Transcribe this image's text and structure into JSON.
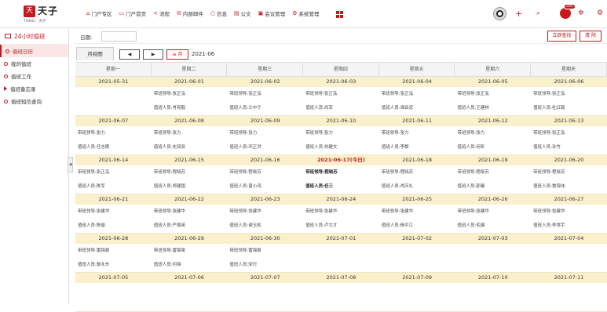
{
  "logo": {
    "brand": "天子",
    "mark": "天",
    "sub": "TIANZI · 天子"
  },
  "nav": [
    {
      "icon": "⌂",
      "label": "门户专区"
    },
    {
      "icon": "▭",
      "label": "门户首页"
    },
    {
      "icon": "<",
      "label": "流程"
    },
    {
      "icon": "✉",
      "label": "内部邮件"
    },
    {
      "icon": "○",
      "label": "信息"
    },
    {
      "icon": "▤",
      "label": "公文"
    },
    {
      "icon": "▣",
      "label": "会议管理"
    },
    {
      "icon": "⚙",
      "label": "系统管理"
    }
  ],
  "header": {
    "badge_count": "205",
    "accent": "#c8161d"
  },
  "sidebar": {
    "title": "24小时值班",
    "items": [
      {
        "label": "值班日历",
        "active": true,
        "icon": "dot"
      },
      {
        "label": "我的值班",
        "active": false,
        "icon": "dot"
      },
      {
        "label": "值班工作",
        "active": false,
        "icon": "dot"
      },
      {
        "label": "值班备忘录",
        "active": false,
        "icon": "tri"
      },
      {
        "label": "值班短信查询",
        "active": false,
        "icon": "dot"
      }
    ]
  },
  "filter": {
    "date_label": "日期:",
    "date_value": "",
    "search_label": "立即查找",
    "clear_label": "清 除"
  },
  "toolbar": {
    "view_tab": "月视图",
    "prev": "◀",
    "next": "▶",
    "month_btn": "≡ 月",
    "current_month": "2021-06"
  },
  "calendar": {
    "weekdays": [
      "星期一",
      "星期二",
      "星期三",
      "星期四",
      "星期五",
      "星期六",
      "星期天"
    ],
    "leader_label": "带班领导:",
    "staff_label": "值班人员:",
    "weeks": [
      {
        "days": [
          {
            "date": "2021-05-31",
            "leader": "",
            "staff": ""
          },
          {
            "date": "2021-06-01",
            "leader": "张正泓",
            "staff": "肖亮毅"
          },
          {
            "date": "2021-06-02",
            "leader": "张正泓",
            "staff": "兰中于"
          },
          {
            "date": "2021-06-03",
            "leader": "张正泓",
            "staff": "尚军"
          },
          {
            "date": "2021-06-04",
            "leader": "张正泓",
            "staff": "谭岳忠"
          },
          {
            "date": "2021-06-05",
            "leader": "张正泓",
            "staff": "王建林"
          },
          {
            "date": "2021-06-06",
            "leader": "张正泓",
            "staff": "杜红毅"
          }
        ]
      },
      {
        "days": [
          {
            "date": "2021-06-07",
            "leader": "张力",
            "staff": "任志刚"
          },
          {
            "date": "2021-06-08",
            "leader": "张力",
            "staff": "史双双"
          },
          {
            "date": "2021-06-09",
            "leader": "张力",
            "staff": "邓正洪"
          },
          {
            "date": "2021-06-10",
            "leader": "张力",
            "staff": "刘建文"
          },
          {
            "date": "2021-06-11",
            "leader": "张力",
            "staff": "李黎"
          },
          {
            "date": "2021-06-12",
            "leader": "张力",
            "staff": "何昕"
          },
          {
            "date": "2021-06-13",
            "leader": "张正泓",
            "staff": "孙竹"
          }
        ]
      },
      {
        "days": [
          {
            "date": "2021-06-14",
            "leader": "张正泓",
            "staff": "陈军"
          },
          {
            "date": "2021-06-15",
            "leader": "程晓苏",
            "staff": "郑建国"
          },
          {
            "date": "2021-06-16",
            "leader": "程晓苏",
            "staff": "曾小鸿"
          },
          {
            "date": "2021-06-17(今日)",
            "leader": "程晓苏",
            "staff": "任三",
            "today": true
          },
          {
            "date": "2021-06-18",
            "leader": "程晓苏",
            "staff": "肖庆礼"
          },
          {
            "date": "2021-06-19",
            "leader": "程晓苏",
            "staff": "郭曦"
          },
          {
            "date": "2021-06-20",
            "leader": "程晓苏",
            "staff": "詹锦伟"
          }
        ]
      },
      {
        "days": [
          {
            "date": "2021-06-21",
            "leader": "张建华",
            "staff": "陈瑜"
          },
          {
            "date": "2021-06-22",
            "leader": "张建华",
            "staff": "严焕英"
          },
          {
            "date": "2021-06-23",
            "leader": "张建华",
            "staff": "谢玉松"
          },
          {
            "date": "2021-06-24",
            "leader": "张建华",
            "staff": "卢文才"
          },
          {
            "date": "2021-06-25",
            "leader": "张建华",
            "staff": "杨平江"
          },
          {
            "date": "2021-06-26",
            "leader": "张建华",
            "staff": "毛健"
          },
          {
            "date": "2021-06-27",
            "leader": "张建华",
            "staff": "李常宇"
          }
        ]
      },
      {
        "days": [
          {
            "date": "2021-06-28",
            "leader": "雷锦泉",
            "staff": "黎永东"
          },
          {
            "date": "2021-06-29",
            "leader": "雷锦泉",
            "staff": "何强"
          },
          {
            "date": "2021-06-30",
            "leader": "雷锦泉",
            "staff": "宋行"
          },
          {
            "date": "2021-07-01",
            "leader": "",
            "staff": ""
          },
          {
            "date": "2021-07-02",
            "leader": "",
            "staff": ""
          },
          {
            "date": "2021-07-03",
            "leader": "",
            "staff": ""
          },
          {
            "date": "2021-07-04",
            "leader": "",
            "staff": ""
          }
        ]
      },
      {
        "days": [
          {
            "date": "2021-07-05",
            "leader": "",
            "staff": ""
          },
          {
            "date": "2021-07-06",
            "leader": "",
            "staff": ""
          },
          {
            "date": "2021-07-07",
            "leader": "",
            "staff": ""
          },
          {
            "date": "2021-07-08",
            "leader": "",
            "staff": ""
          },
          {
            "date": "2021-07-09",
            "leader": "",
            "staff": ""
          },
          {
            "date": "2021-07-10",
            "leader": "",
            "staff": ""
          },
          {
            "date": "2021-07-11",
            "leader": "",
            "staff": ""
          }
        ]
      }
    ]
  }
}
